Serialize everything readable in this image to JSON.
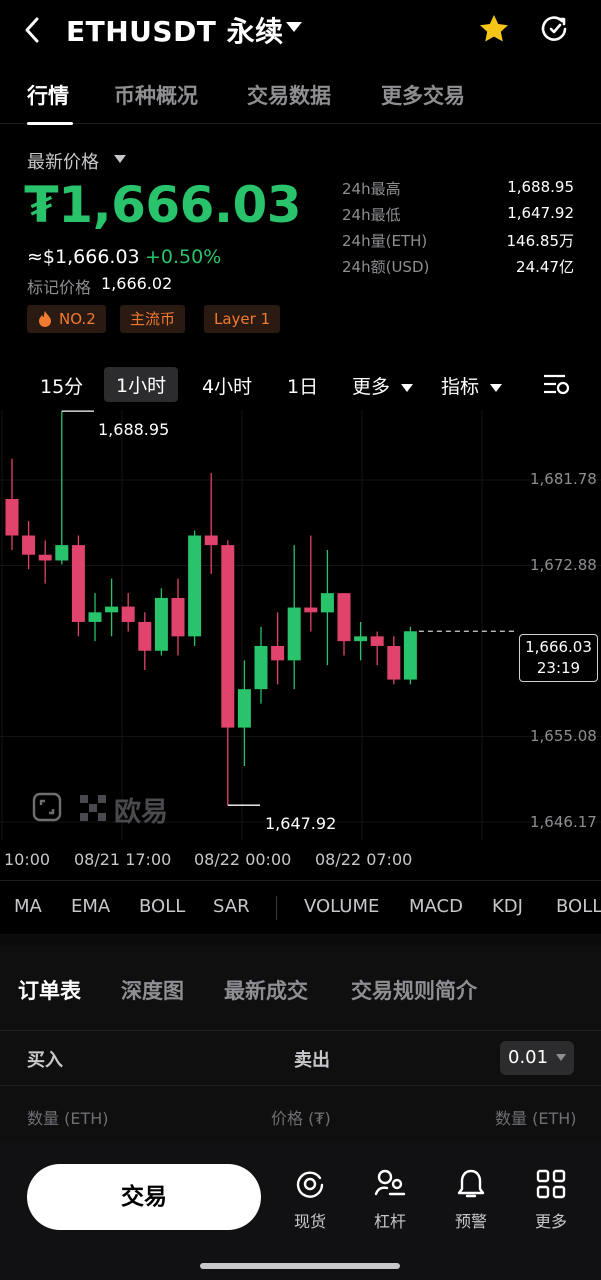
{
  "header": {
    "title": "ETHUSDT 永续",
    "back_icon": "back-arrow-icon",
    "star_color": "#f5c518"
  },
  "tabs": [
    "行情",
    "币种概况",
    "交易数据",
    "更多交易"
  ],
  "price": {
    "label": "最新价格",
    "value": "₮1,666.03",
    "usd": "≈$1,666.03",
    "change": "+0.50%",
    "mark_label": "标记价格",
    "mark_value": "1,666.02",
    "color_up": "#28c36a",
    "color_down": "#e0436b"
  },
  "stats": [
    {
      "label": "24h最高",
      "value": "1,688.95"
    },
    {
      "label": "24h最低",
      "value": "1,647.92"
    },
    {
      "label": "24h量(ETH)",
      "value": "146.85万"
    },
    {
      "label": "24h额(USD)",
      "value": "24.47亿"
    }
  ],
  "tags": [
    "NO.2",
    "主流币",
    "Layer 1"
  ],
  "intervals": {
    "m15": "15分",
    "h1": "1小时",
    "h4": "4小时",
    "d1": "1日",
    "more": "更多",
    "indicators": "指标"
  },
  "chart_data": {
    "type": "candlestick",
    "y_ticks": [
      "1,681.78",
      "1,672.88",
      "1,655.08",
      "1,646.17"
    ],
    "y_tick_values": [
      1681.78,
      1672.88,
      1655.08,
      1646.17
    ],
    "x_ticks": [
      "10:00",
      "08/21 17:00",
      "08/22 00:00",
      "08/22 07:00"
    ],
    "high_label": "1,688.95",
    "low_label": "1,647.92",
    "current_price": "1,666.03",
    "countdown": "23:19",
    "watermark": "欧易",
    "candles": [
      [
        1679.8,
        1684.0,
        1674.5,
        1676.0
      ],
      [
        1676.0,
        1677.5,
        1672.5,
        1674.0
      ],
      [
        1674.0,
        1675.5,
        1671.0,
        1673.4
      ],
      [
        1673.4,
        1688.95,
        1673.0,
        1675.0
      ],
      [
        1675.0,
        1676.0,
        1665.5,
        1667.0
      ],
      [
        1667.0,
        1670.0,
        1665.0,
        1668.0
      ],
      [
        1668.0,
        1671.5,
        1665.5,
        1668.6
      ],
      [
        1668.6,
        1670.0,
        1666.0,
        1667.0
      ],
      [
        1667.0,
        1668.0,
        1662.0,
        1664.0
      ],
      [
        1664.0,
        1670.5,
        1663.5,
        1669.5
      ],
      [
        1669.5,
        1671.5,
        1663.5,
        1665.5
      ],
      [
        1665.5,
        1676.5,
        1664.5,
        1676.0
      ],
      [
        1676.0,
        1682.5,
        1672.0,
        1675.0
      ],
      [
        1675.0,
        1675.5,
        1647.92,
        1656.0
      ],
      [
        1656.0,
        1663.0,
        1652.0,
        1660.0
      ],
      [
        1660.0,
        1666.5,
        1658.5,
        1664.5
      ],
      [
        1664.5,
        1668.0,
        1660.5,
        1663.0
      ],
      [
        1663.0,
        1675.0,
        1660.0,
        1668.5
      ],
      [
        1668.5,
        1676.0,
        1666.0,
        1668.0
      ],
      [
        1668.0,
        1674.5,
        1662.5,
        1670.0
      ],
      [
        1670.0,
        1670.0,
        1663.5,
        1665.0
      ],
      [
        1665.0,
        1667.0,
        1663.0,
        1665.5
      ],
      [
        1665.5,
        1666.0,
        1662.5,
        1664.5
      ],
      [
        1664.5,
        1665.5,
        1660.5,
        1661.0
      ],
      [
        1661.0,
        1666.5,
        1660.5,
        1666.03
      ]
    ]
  },
  "indicators": [
    "MA",
    "EMA",
    "BOLL",
    "SAR",
    "VOLUME",
    "MACD",
    "KDJ",
    "BOLL"
  ],
  "order_tabs": [
    "订单表",
    "深度图",
    "最新成交",
    "交易规则简介"
  ],
  "orderbook": {
    "buy": "买入",
    "sell": "卖出",
    "precision": "0.01",
    "col_qty_left": "数量 (ETH)",
    "col_price": "价格 (₮)",
    "col_qty_right": "数量 (ETH)"
  },
  "bottom": {
    "trade_button": "交易",
    "nav": [
      {
        "label": "现货",
        "icon": "spot-icon"
      },
      {
        "label": "杠杆",
        "icon": "margin-icon"
      },
      {
        "label": "预警",
        "icon": "bell-icon"
      },
      {
        "label": "更多",
        "icon": "grid-icon"
      }
    ]
  }
}
